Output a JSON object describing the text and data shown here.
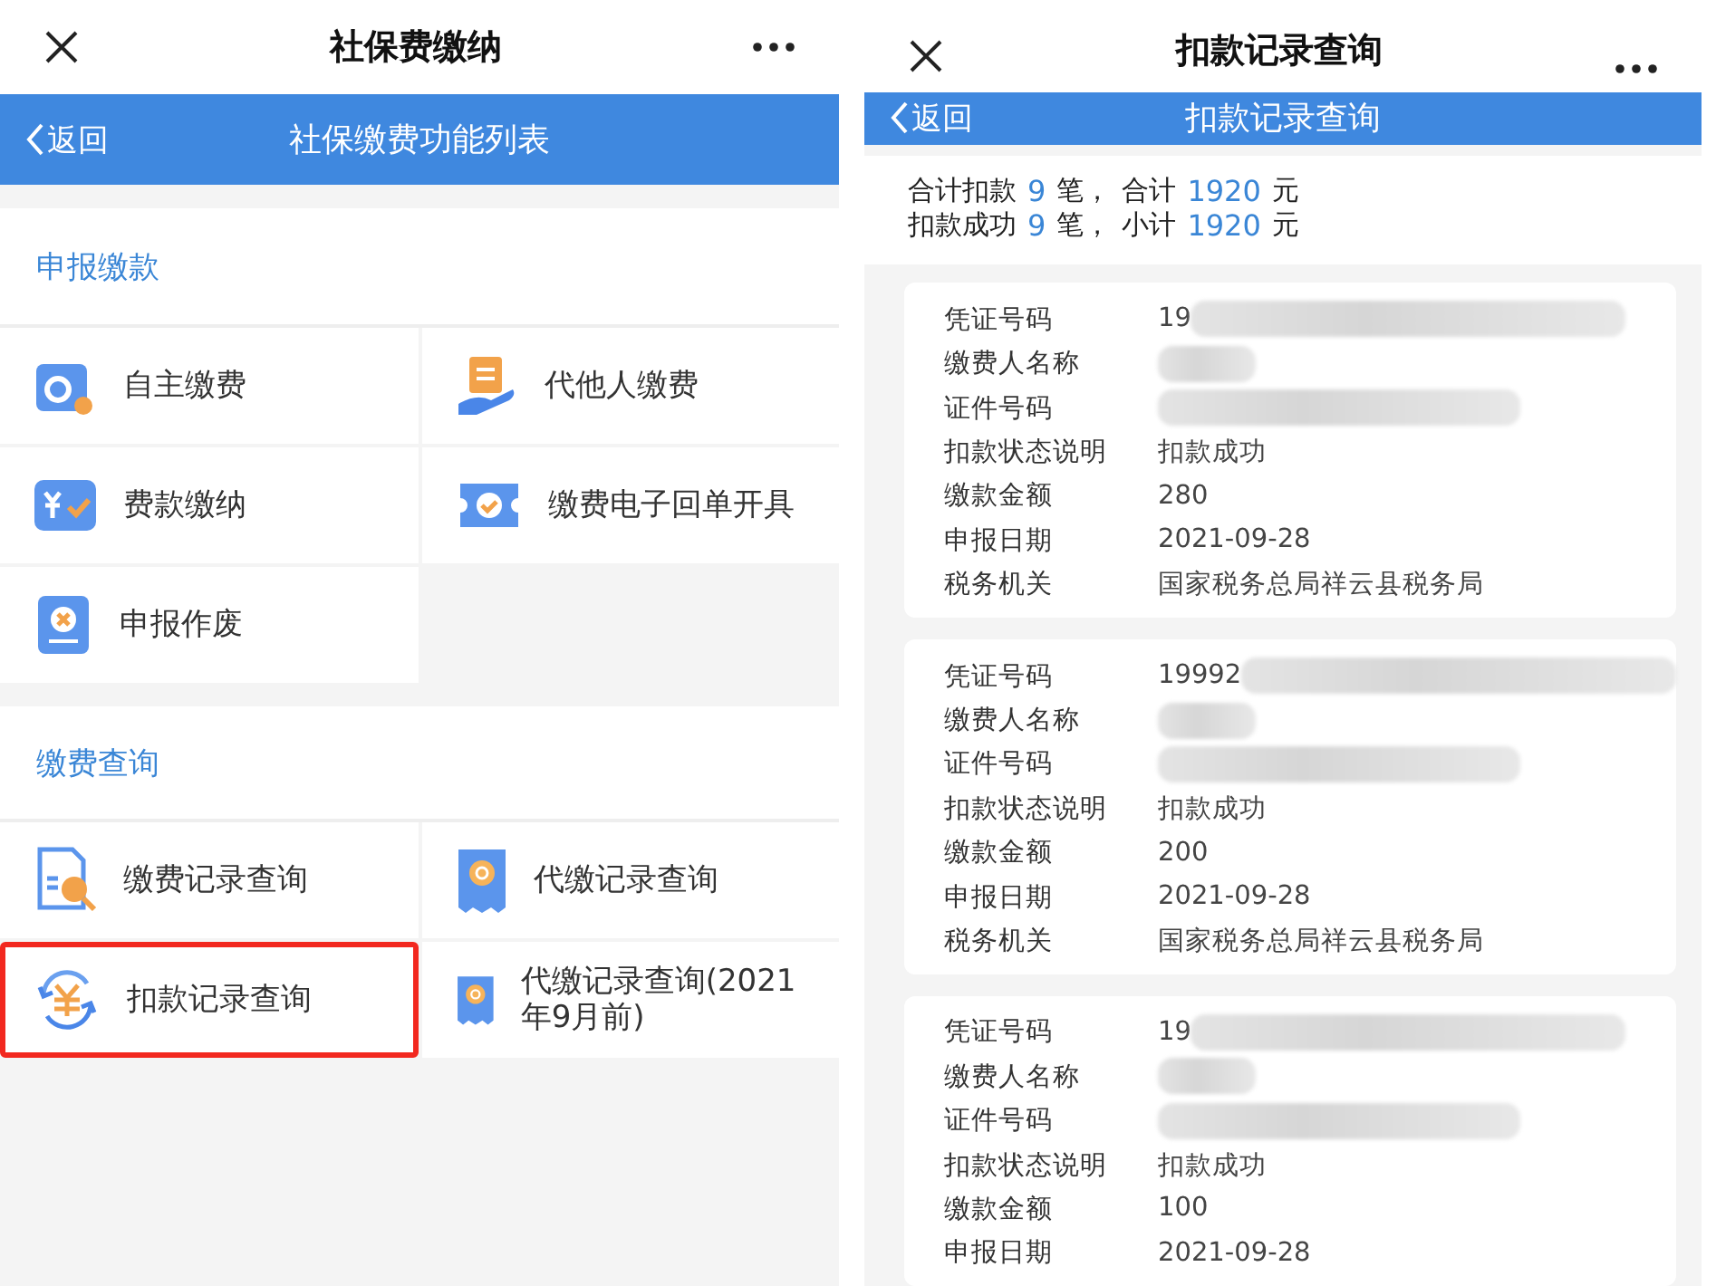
{
  "left_screen": {
    "window": {
      "title": "社保费缴纳"
    },
    "nav_bar": {
      "back": "返回",
      "title": "社保缴费功能列表"
    },
    "sections": [
      {
        "title": "申报缴款",
        "items": [
          {
            "label": "自主缴费",
            "selected": false
          },
          {
            "label": "代他人缴费",
            "selected": false
          },
          {
            "label": "费款缴纳",
            "selected": false
          },
          {
            "label": "缴费电子回单开具",
            "selected": false
          },
          {
            "label": "申报作废",
            "selected": false
          }
        ]
      },
      {
        "title": "缴费查询",
        "items": [
          {
            "label": "缴费记录查询",
            "selected": false
          },
          {
            "label": "代缴记录查询",
            "selected": false
          },
          {
            "label": "扣款记录查询",
            "selected": true
          },
          {
            "label": "代缴记录查询(2021年9月前)",
            "selected": false
          }
        ]
      }
    ]
  },
  "right_screen": {
    "window": {
      "title": "扣款记录查询"
    },
    "nav_bar": {
      "back": "返回",
      "title": "扣款记录查询"
    },
    "summary": [
      {
        "label": "合计扣款",
        "count": "9",
        "count_unit": "笔，",
        "total_label": "合计",
        "amount": "1920",
        "currency": "元"
      },
      {
        "label": "扣款成功",
        "count": "9",
        "count_unit": "笔，",
        "total_label": "小计",
        "amount": "1920",
        "currency": "元"
      }
    ],
    "records": [
      {
        "fields": [
          {
            "label": "凭证号码",
            "value": "19",
            "redacted": true
          },
          {
            "label": "缴费人名称",
            "redacted": true
          },
          {
            "label": "证件号码",
            "redacted": true
          },
          {
            "label": "扣款状态说明",
            "value": "扣款成功"
          },
          {
            "label": "缴款金额",
            "value": "280"
          },
          {
            "label": "申报日期",
            "value": "2021-09-28"
          },
          {
            "label": "税务机关",
            "value": "国家税务总局祥云县税务局"
          }
        ]
      },
      {
        "fields": [
          {
            "label": "凭证号码",
            "value": "19992",
            "redacted": true
          },
          {
            "label": "缴费人名称",
            "redacted": true
          },
          {
            "label": "证件号码",
            "redacted": true
          },
          {
            "label": "扣款状态说明",
            "value": "扣款成功"
          },
          {
            "label": "缴款金额",
            "value": "200"
          },
          {
            "label": "申报日期",
            "value": "2021-09-28"
          },
          {
            "label": "税务机关",
            "value": "国家税务总局祥云县税务局"
          }
        ]
      },
      {
        "fields": [
          {
            "label": "凭证号码",
            "value": "19",
            "redacted": true
          },
          {
            "label": "缴费人名称",
            "redacted": true
          },
          {
            "label": "证件号码",
            "redacted": true
          },
          {
            "label": "扣款状态说明",
            "value": "扣款成功"
          },
          {
            "label": "缴款金额",
            "value": "100"
          },
          {
            "label": "申报日期",
            "value": "2021-09-28"
          }
        ]
      }
    ]
  }
}
